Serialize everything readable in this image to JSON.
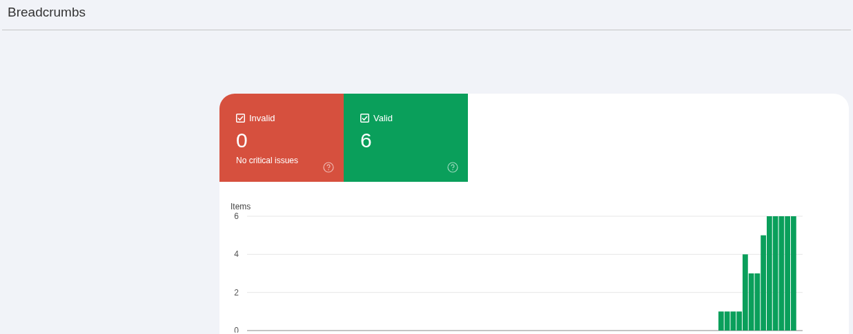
{
  "page": {
    "title": "Breadcrumbs"
  },
  "tiles": [
    {
      "label": "Invalid",
      "checked": true,
      "count": "0",
      "note": "No critical issues",
      "color": "#d6503e"
    },
    {
      "label": "Valid",
      "checked": true,
      "count": "6",
      "color": "#0a9f5b"
    }
  ],
  "chart": {
    "chart_data": {
      "type": "bar",
      "ylabel": "Items",
      "ylim": [
        0,
        6
      ],
      "yticks": [
        0,
        2,
        4,
        6
      ],
      "series": [
        {
          "color": "#0a9f5b",
          "values": [
            0,
            0,
            0,
            0,
            0,
            0,
            0,
            0,
            0,
            0,
            0,
            0,
            0,
            0,
            0,
            0,
            0,
            0,
            0,
            0,
            0,
            0,
            0,
            0,
            0,
            0,
            0,
            0,
            0,
            0,
            0,
            0,
            0,
            0,
            0,
            0,
            0,
            0,
            0,
            0,
            0,
            0,
            0,
            0,
            0,
            0,
            0,
            0,
            0,
            0,
            0,
            0,
            0,
            0,
            0,
            0,
            0,
            0,
            0,
            0,
            0,
            0,
            0,
            0,
            0,
            0,
            0,
            0,
            0,
            0,
            0,
            0,
            0,
            0,
            0,
            0,
            0,
            0,
            1,
            1,
            1,
            1,
            4,
            3,
            3,
            5,
            6,
            6,
            6,
            6,
            6,
            0
          ]
        }
      ]
    }
  }
}
